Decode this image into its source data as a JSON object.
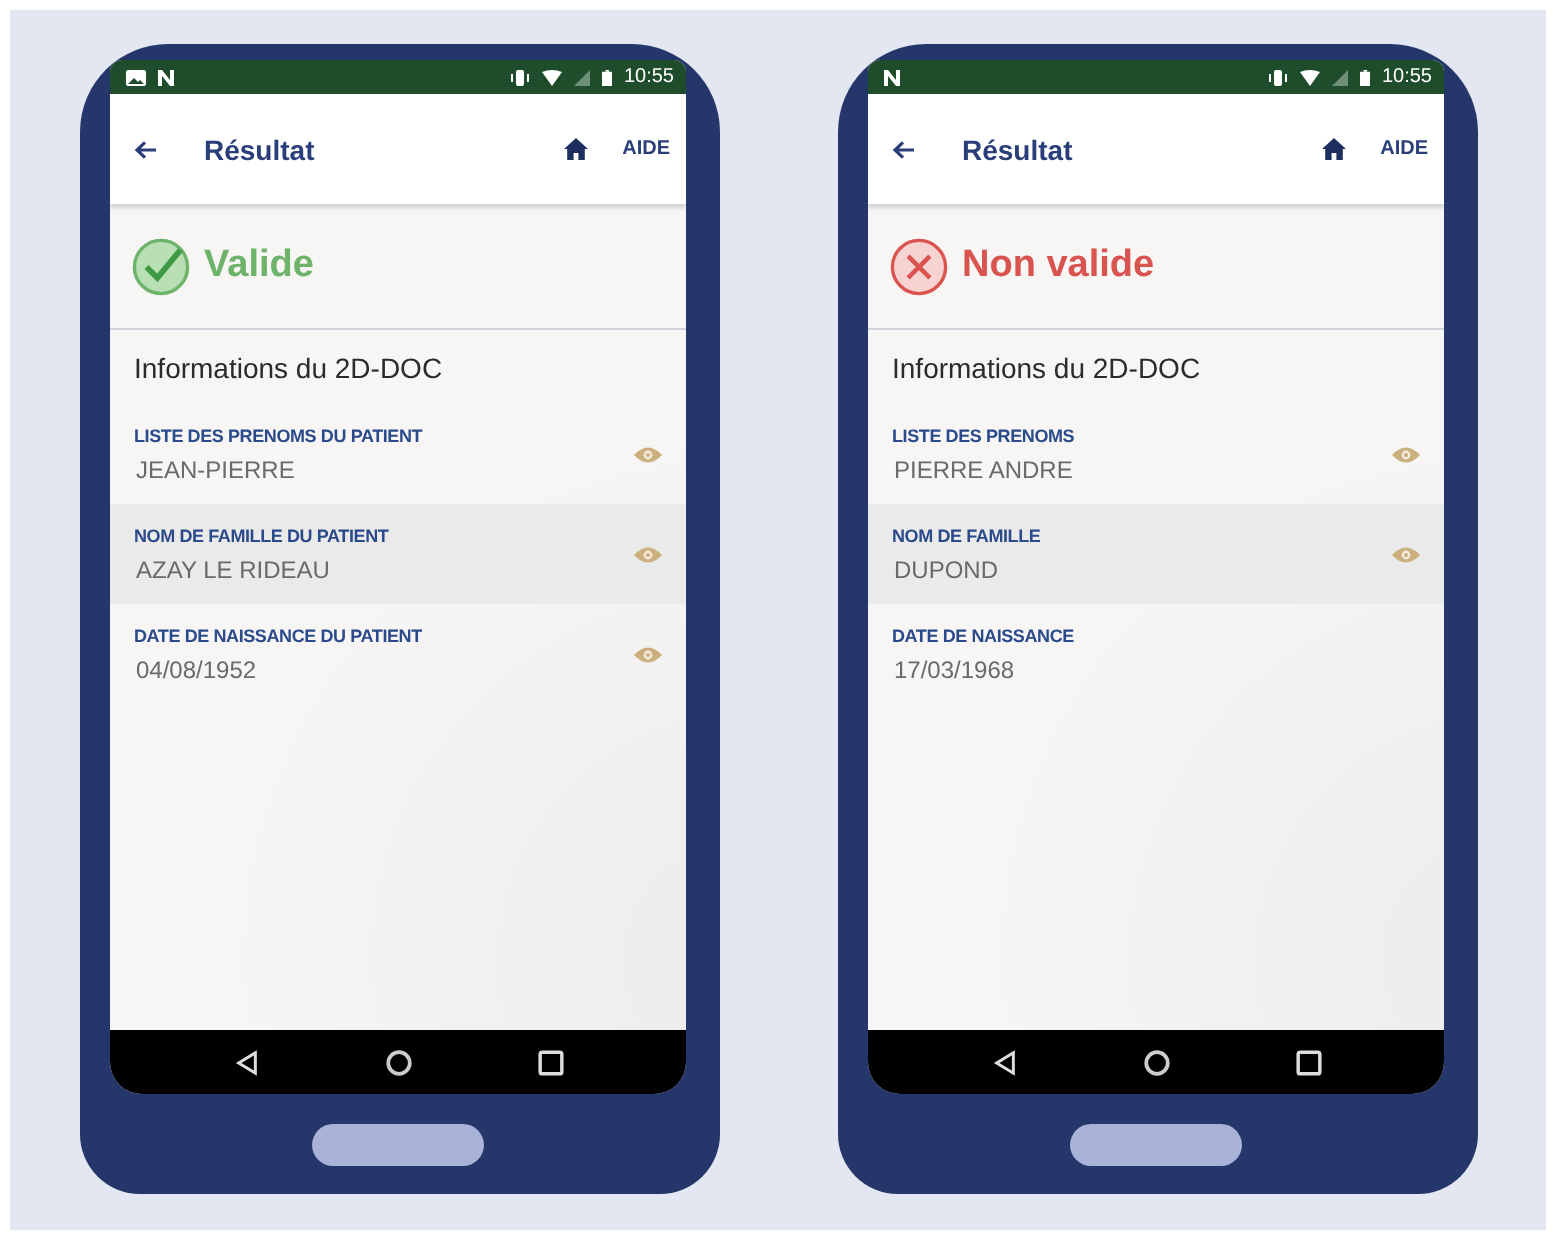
{
  "phones": [
    {
      "status_bar": {
        "photo_notification": true,
        "time": "10:55"
      },
      "app_bar": {
        "title": "Résultat",
        "help": "AIDE"
      },
      "result": {
        "kind": "valid",
        "label": "Valide"
      },
      "section_title": "Informations du 2D-DOC",
      "fields": [
        {
          "label": "LISTE DES PRENOMS DU PATIENT",
          "value": "JEAN-PIERRE",
          "selected": false,
          "reveal_icon": true
        },
        {
          "label": "NOM DE FAMILLE DU PATIENT",
          "value": "AZAY LE RIDEAU",
          "selected": true,
          "reveal_icon": true
        },
        {
          "label": "DATE DE NAISSANCE DU PATIENT",
          "value": "04/08/1952",
          "selected": false,
          "reveal_icon": true
        }
      ]
    },
    {
      "status_bar": {
        "photo_notification": false,
        "time": "10:55"
      },
      "app_bar": {
        "title": "Résultat",
        "help": "AIDE"
      },
      "result": {
        "kind": "invalid",
        "label": "Non valide"
      },
      "section_title": "Informations du 2D-DOC",
      "fields": [
        {
          "label": "LISTE DES PRENOMS",
          "value": "PIERRE ANDRE",
          "selected": false,
          "reveal_icon": true
        },
        {
          "label": "NOM DE FAMILLE",
          "value": "DUPOND",
          "selected": true,
          "reveal_icon": true
        },
        {
          "label": "DATE DE NAISSANCE",
          "value": "17/03/1968",
          "selected": false,
          "reveal_icon": false
        }
      ]
    }
  ]
}
